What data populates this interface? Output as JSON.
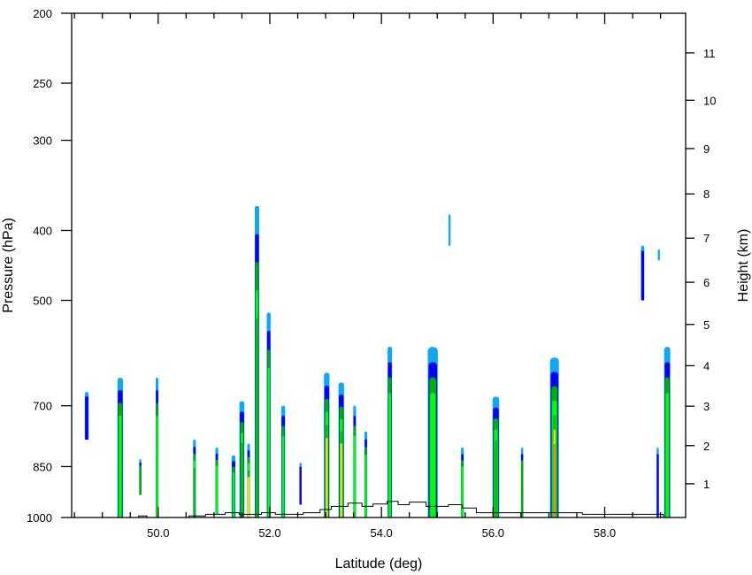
{
  "chart_data": {
    "type": "contour",
    "xlabel": "Latitude (deg)",
    "ylabel": "Pressure (hPa)",
    "y2label": "Height (km)",
    "xlim": [
      48.45,
      59.45
    ],
    "ylim": [
      1000,
      200
    ],
    "yscale": "log",
    "x_ticks": [
      {
        "value": 50.0,
        "label": "50.0"
      },
      {
        "value": 52.0,
        "label": "52.0"
      },
      {
        "value": 54.0,
        "label": "54.0"
      },
      {
        "value": 56.0,
        "label": "56.0"
      },
      {
        "value": 58.0,
        "label": "58.0"
      }
    ],
    "y_ticks": [
      {
        "value": 200,
        "label": "200"
      },
      {
        "value": 250,
        "label": "250"
      },
      {
        "value": 300,
        "label": "300"
      },
      {
        "value": 400,
        "label": "400"
      },
      {
        "value": 500,
        "label": "500"
      },
      {
        "value": 700,
        "label": "700"
      },
      {
        "value": 850,
        "label": "850"
      },
      {
        "value": 1000,
        "label": "1000"
      }
    ],
    "height_ticks": [
      {
        "km": 1,
        "p": 898,
        "label": "1"
      },
      {
        "km": 2,
        "p": 795,
        "label": "2"
      },
      {
        "km": 3,
        "p": 701,
        "label": "3"
      },
      {
        "km": 4,
        "p": 616,
        "label": "4"
      },
      {
        "km": 5,
        "p": 540,
        "label": "5"
      },
      {
        "km": 6,
        "p": 472,
        "label": "6"
      },
      {
        "km": 7,
        "p": 410,
        "label": "7"
      },
      {
        "km": 8,
        "p": 356,
        "label": "8"
      },
      {
        "km": 9,
        "p": 308,
        "label": "9"
      },
      {
        "km": 10,
        "p": 264,
        "label": "10"
      },
      {
        "km": 11,
        "p": 227,
        "label": "11"
      }
    ],
    "colors": [
      "#10a8f0",
      "#0000ff",
      "#00b000",
      "#00ff00",
      "#00c000",
      "#f0e000",
      "#ff8040"
    ],
    "cells": [
      {
        "lat": 48.72,
        "w": 0.07,
        "top": 670,
        "bottom": 780,
        "levels": 2
      },
      {
        "lat": 49.32,
        "w": 0.1,
        "top": 640,
        "bottom": 1000,
        "levels": 4
      },
      {
        "lat": 49.68,
        "w": 0.03,
        "top": 830,
        "bottom": 930,
        "levels": 3
      },
      {
        "lat": 49.98,
        "w": 0.05,
        "top": 640,
        "bottom": 1000,
        "levels": 4
      },
      {
        "lat": 50.65,
        "w": 0.05,
        "top": 780,
        "bottom": 1000,
        "levels": 5
      },
      {
        "lat": 51.05,
        "w": 0.05,
        "top": 800,
        "bottom": 990,
        "levels": 4
      },
      {
        "lat": 51.35,
        "w": 0.07,
        "top": 820,
        "bottom": 1000,
        "levels": 4
      },
      {
        "lat": 51.5,
        "w": 0.09,
        "top": 690,
        "bottom": 1000,
        "levels": 5
      },
      {
        "lat": 51.62,
        "w": 0.05,
        "top": 790,
        "bottom": 1000,
        "levels": 6
      },
      {
        "lat": 51.77,
        "w": 0.08,
        "top": 370,
        "bottom": 1000,
        "levels": 5
      },
      {
        "lat": 51.98,
        "w": 0.07,
        "top": 520,
        "bottom": 1000,
        "levels": 4
      },
      {
        "lat": 52.24,
        "w": 0.07,
        "top": 700,
        "bottom": 1000,
        "levels": 4
      },
      {
        "lat": 52.55,
        "w": 0.03,
        "top": 840,
        "bottom": 960,
        "levels": 2
      },
      {
        "lat": 53.02,
        "w": 0.1,
        "top": 630,
        "bottom": 1000,
        "levels": 6
      },
      {
        "lat": 53.28,
        "w": 0.1,
        "top": 650,
        "bottom": 1000,
        "levels": 6
      },
      {
        "lat": 53.52,
        "w": 0.05,
        "top": 700,
        "bottom": 1000,
        "levels": 4
      },
      {
        "lat": 53.72,
        "w": 0.05,
        "top": 760,
        "bottom": 1000,
        "levels": 4
      },
      {
        "lat": 54.15,
        "w": 0.08,
        "top": 580,
        "bottom": 1000,
        "levels": 4
      },
      {
        "lat": 54.92,
        "w": 0.18,
        "top": 580,
        "bottom": 1000,
        "levels": 4
      },
      {
        "lat": 55.22,
        "w": 0.03,
        "top": 380,
        "bottom": 420,
        "levels": 1
      },
      {
        "lat": 55.45,
        "w": 0.05,
        "top": 800,
        "bottom": 1000,
        "levels": 4
      },
      {
        "lat": 56.05,
        "w": 0.12,
        "top": 680,
        "bottom": 1000,
        "levels": 5
      },
      {
        "lat": 56.52,
        "w": 0.04,
        "top": 800,
        "bottom": 1000,
        "levels": 3
      },
      {
        "lat": 57.1,
        "w": 0.16,
        "top": 600,
        "bottom": 1000,
        "levels": 7
      },
      {
        "lat": 58.68,
        "w": 0.06,
        "top": 420,
        "bottom": 500,
        "levels": 2
      },
      {
        "lat": 58.97,
        "w": 0.03,
        "top": 425,
        "bottom": 440,
        "levels": 1
      },
      {
        "lat": 58.95,
        "w": 0.04,
        "top": 800,
        "bottom": 1000,
        "levels": 2
      },
      {
        "lat": 59.12,
        "w": 0.11,
        "top": 580,
        "bottom": 1000,
        "levels": 4
      }
    ],
    "terrain": [
      [
        48.45,
        1000
      ],
      [
        49.65,
        1000
      ],
      [
        49.65,
        995
      ],
      [
        49.8,
        995
      ],
      [
        49.8,
        1000
      ],
      [
        50.55,
        1000
      ],
      [
        50.55,
        995
      ],
      [
        50.85,
        995
      ],
      [
        50.85,
        990
      ],
      [
        51.2,
        990
      ],
      [
        51.2,
        985
      ],
      [
        51.45,
        985
      ],
      [
        51.45,
        990
      ],
      [
        51.85,
        990
      ],
      [
        51.85,
        985
      ],
      [
        52.1,
        985
      ],
      [
        52.1,
        990
      ],
      [
        52.6,
        990
      ],
      [
        52.6,
        985
      ],
      [
        52.9,
        985
      ],
      [
        52.9,
        975
      ],
      [
        53.1,
        975
      ],
      [
        53.1,
        965
      ],
      [
        53.4,
        965
      ],
      [
        53.4,
        955
      ],
      [
        53.65,
        955
      ],
      [
        53.65,
        965
      ],
      [
        53.85,
        965
      ],
      [
        53.85,
        958
      ],
      [
        54.1,
        958
      ],
      [
        54.1,
        950
      ],
      [
        54.3,
        950
      ],
      [
        54.3,
        960
      ],
      [
        54.5,
        960
      ],
      [
        54.5,
        952
      ],
      [
        54.8,
        952
      ],
      [
        54.8,
        965
      ],
      [
        55.2,
        965
      ],
      [
        55.2,
        960
      ],
      [
        55.45,
        960
      ],
      [
        55.45,
        970
      ],
      [
        55.7,
        970
      ],
      [
        55.7,
        985
      ],
      [
        57.6,
        985
      ],
      [
        57.6,
        990
      ],
      [
        59.05,
        990
      ],
      [
        59.05,
        1000
      ],
      [
        59.45,
        1000
      ]
    ]
  }
}
